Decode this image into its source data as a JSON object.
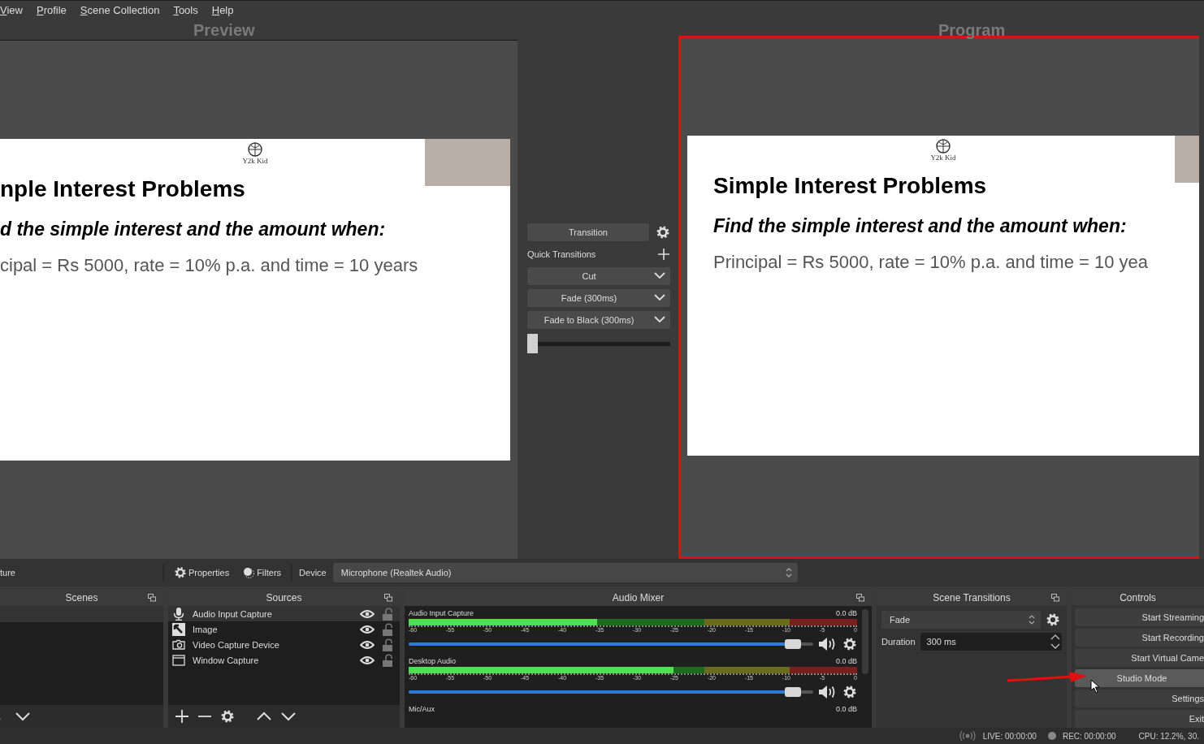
{
  "menu": [
    {
      "label": "View"
    },
    {
      "label": "Profile"
    },
    {
      "label": "Scene Collection"
    },
    {
      "label": "Tools"
    },
    {
      "label": "Help"
    }
  ],
  "preview": {
    "label": "Preview",
    "slide": {
      "logo_text": "Y2k Kid",
      "title": "nple Interest Problems",
      "subtitle": "d the simple interest and the amount when:",
      "body": "cipal = Rs 5000, rate = 10% p.a. and time = 10 years"
    }
  },
  "transitions_column": {
    "transition_button": "Transition",
    "quick_label": "Quick Transitions",
    "quick": [
      {
        "label": "Cut"
      },
      {
        "label": "Fade (300ms)"
      },
      {
        "label": "Fade to Black (300ms)"
      }
    ],
    "tbar": {
      "level": 0
    }
  },
  "program": {
    "label": "Program",
    "slide": {
      "logo_text": "Y2k Kid",
      "title": "Simple Interest Problems",
      "subtitle": "Find the simple interest and the amount when:",
      "body": "Principal = Rs 5000, rate = 10% p.a. and time = 10 yea"
    }
  },
  "toolbar": {
    "source_name": "ture",
    "properties": "Properties",
    "filters": "Filters",
    "device_label": "Device",
    "device_value": "Microphone (Realtek Audio)"
  },
  "scenes": {
    "title": "Scenes"
  },
  "sources": {
    "title": "Sources",
    "items": [
      {
        "name": "Audio Input Capture",
        "kind": "mic",
        "visible": true,
        "locked": false,
        "selected": true
      },
      {
        "name": "Image",
        "kind": "image",
        "visible": true,
        "locked": false,
        "selected": false
      },
      {
        "name": "Video Capture Device",
        "kind": "camera",
        "visible": true,
        "locked": false,
        "selected": false
      },
      {
        "name": "Window Capture",
        "kind": "window",
        "visible": true,
        "locked": false,
        "selected": false
      }
    ]
  },
  "mixer": {
    "title": "Audio Mixer",
    "channels": [
      {
        "name": "Audio Input Capture",
        "db": "0.0 dB",
        "meter": {
          "level": 0.42
        },
        "volume": {
          "level": 0.97
        },
        "scale": [
          "-60",
          "-55",
          "-50",
          "-45",
          "-40",
          "-35",
          "-30",
          "-25",
          "-20",
          "-15",
          "-10",
          "-5",
          "0"
        ]
      },
      {
        "name": "Desktop Audio",
        "db": "0.0 dB",
        "meter": {
          "level": 0.59
        },
        "volume": {
          "level": 0.97
        },
        "scale": [
          "-60",
          "-55",
          "-50",
          "-45",
          "-40",
          "-35",
          "-30",
          "-25",
          "-20",
          "-15",
          "-10",
          "-5",
          "0"
        ]
      },
      {
        "name": "Mic/Aux",
        "db": "0.0 dB"
      }
    ]
  },
  "scene_transitions": {
    "title": "Scene Transitions",
    "transition": "Fade",
    "duration_label": "Duration",
    "duration": "300 ms"
  },
  "controls": {
    "title": "Controls",
    "buttons": [
      {
        "label": "Start Streaming",
        "hovered": false
      },
      {
        "label": "Start Recording",
        "hovered": false
      },
      {
        "label": "Start Virtual Came",
        "hovered": false
      },
      {
        "label": "Studio Mode",
        "hovered": true
      },
      {
        "label": "Settings",
        "hovered": false
      },
      {
        "label": "Exit",
        "hovered": false
      }
    ]
  },
  "status_bar": {
    "live": "LIVE: 00:00:00",
    "rec": "REC: 00:00:00",
    "cpu": "CPU: 12.2%, 30."
  }
}
